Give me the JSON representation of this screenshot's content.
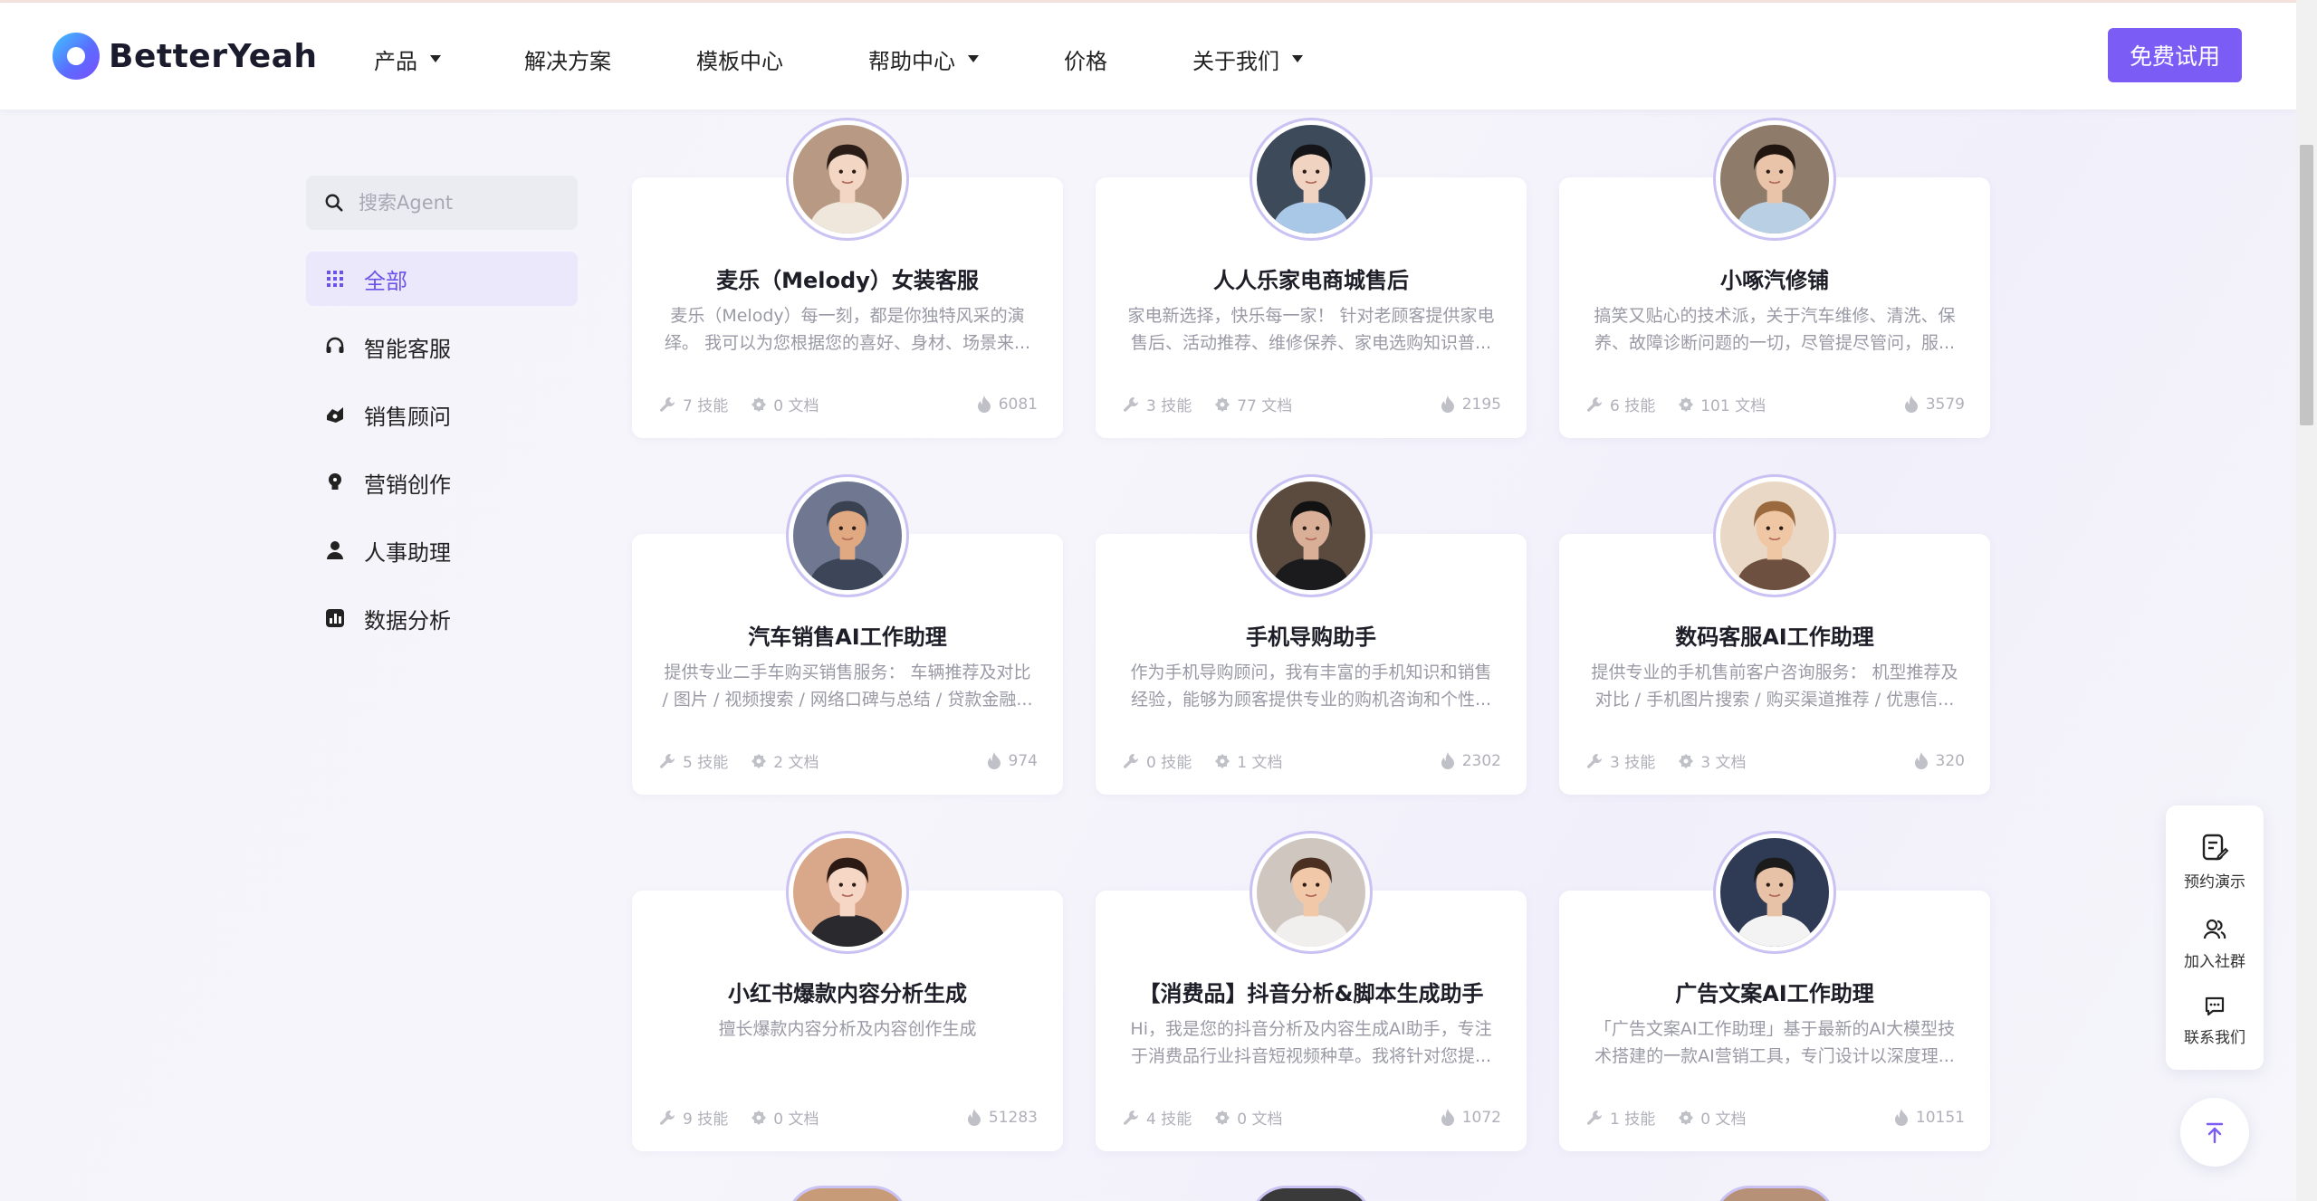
{
  "header": {
    "logo_text": "BetterYeah",
    "nav": [
      {
        "label": "产品",
        "has_dropdown": true
      },
      {
        "label": "解决方案",
        "has_dropdown": false
      },
      {
        "label": "模板中心",
        "has_dropdown": false
      },
      {
        "label": "帮助中心",
        "has_dropdown": true
      },
      {
        "label": "价格",
        "has_dropdown": false
      },
      {
        "label": "关于我们",
        "has_dropdown": true
      }
    ],
    "trial_button": "免费试用"
  },
  "sidebar": {
    "search_placeholder": "搜索Agent",
    "categories": [
      {
        "label": "全部",
        "icon": "grid-icon",
        "active": true
      },
      {
        "label": "智能客服",
        "icon": "headset-icon",
        "active": false
      },
      {
        "label": "销售顾问",
        "icon": "sales-icon",
        "active": false
      },
      {
        "label": "营销创作",
        "icon": "bulb-icon",
        "active": false
      },
      {
        "label": "人事助理",
        "icon": "person-icon",
        "active": false
      },
      {
        "label": "数据分析",
        "icon": "chart-icon",
        "active": false
      }
    ]
  },
  "cards": [
    {
      "title": "麦乐（Melody）女装客服",
      "desc": "麦乐（Melody）每一刻，都是你独特风采的演绎。 我可以为您根据您的喜好、身材、场景来...",
      "skills": "7 技能",
      "docs": "0 文档",
      "heat": "6081",
      "avatar": {
        "bg": "#b89a84",
        "skin": "#f3d6c4",
        "hair": "#2a1c16",
        "cloth": "#efe6dc"
      }
    },
    {
      "title": "人人乐家电商城售后",
      "desc": "家电新选择，快乐每一家！ 针对老顾客提供家电售后、活动推荐、维修保养、家电选购知识普...",
      "skills": "3 技能",
      "docs": "77 文档",
      "heat": "2195",
      "avatar": {
        "bg": "#3c4a5a",
        "skin": "#f1d3c2",
        "hair": "#151518",
        "cloth": "#a9c7e6"
      }
    },
    {
      "title": "小啄汽修铺",
      "desc": "搞笑又贴心的技术派，关于汽车维修、清洗、保养、故障诊断问题的一切，尽管提尽管问，服...",
      "skills": "6 技能",
      "docs": "101 文档",
      "heat": "3579",
      "avatar": {
        "bg": "#8e7b6a",
        "skin": "#eac4a8",
        "hair": "#20160f",
        "cloth": "#b9cfe4"
      }
    },
    {
      "title": "汽车销售AI工作助理",
      "desc": "提供专业二手车购买销售服务： 车辆推荐及对比 / 图片 / 视频搜索 / 网络口碑与总结 / 贷款金融...",
      "skills": "5 技能",
      "docs": "2 文档",
      "heat": "974",
      "avatar": {
        "bg": "#6f7890",
        "skin": "#e0a981",
        "hair": "#3a4150",
        "cloth": "#3c4658"
      }
    },
    {
      "title": "手机导购助手",
      "desc": "作为手机导购顾问，我有丰富的手机知识和销售经验，能够为顾客提供专业的购机咨询和个性...",
      "skills": "0 技能",
      "docs": "1 文档",
      "heat": "2302",
      "avatar": {
        "bg": "#5b4a3e",
        "skin": "#d9b097",
        "hair": "#121212",
        "cloth": "#1b1b1e"
      }
    },
    {
      "title": "数码客服AI工作助理",
      "desc": "提供专业的手机售前客户咨询服务： 机型推荐及对比 / 手机图片搜索 / 购买渠道推荐 / 优惠信...",
      "skills": "3 技能",
      "docs": "3 文档",
      "heat": "320",
      "avatar": {
        "bg": "#e9d8c6",
        "skin": "#f0c7a4",
        "hair": "#9a6a3e",
        "cloth": "#6d5040"
      }
    },
    {
      "title": "小红书爆款内容分析生成",
      "desc": "擅长爆款内容分析及内容创作生成",
      "skills": "9 技能",
      "docs": "0 文档",
      "heat": "51283",
      "avatar": {
        "bg": "#d9a88a",
        "skin": "#f6d7c6",
        "hair": "#2b1a14",
        "cloth": "#2a2a2e"
      }
    },
    {
      "title": "【消费品】抖音分析&脚本生成助手",
      "desc": "Hi，我是您的抖音分析及内容生成AI助手，专注于消费品行业抖音短视频种草。我将针对您提...",
      "skills": "4 技能",
      "docs": "0 文档",
      "heat": "1072",
      "avatar": {
        "bg": "#cfc6c0",
        "skin": "#f1c9a8",
        "hair": "#4b2f21",
        "cloth": "#f1eeee"
      }
    },
    {
      "title": "广告文案AI工作助理",
      "desc": "「广告文案AI工作助理」基于最新的AI大模型技术搭建的一款AI营销工具，专门设计以深度理...",
      "skills": "1 技能",
      "docs": "0 文档",
      "heat": "10151",
      "avatar": {
        "bg": "#2f3b54",
        "skin": "#e8c2a6",
        "hair": "#1b1b1b",
        "cloth": "#f3f3f3"
      }
    }
  ],
  "float_panel": [
    {
      "label": "预约演示",
      "icon": "edit-doc-icon"
    },
    {
      "label": "加入社群",
      "icon": "group-icon"
    },
    {
      "label": "联系我们",
      "icon": "chat-icon"
    }
  ],
  "colors": {
    "accent": "#7b5cf5",
    "active_bg": "#ebe8fb",
    "active_text": "#6c52e8"
  }
}
